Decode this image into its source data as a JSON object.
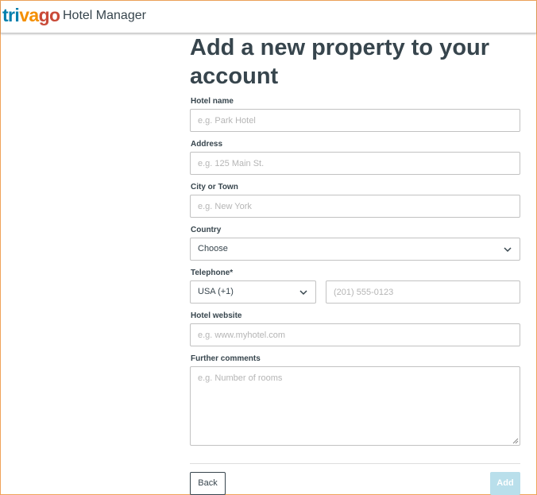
{
  "header": {
    "logo": {
      "part1": "tri",
      "part2": "va",
      "part3": "go"
    },
    "app_name": "Hotel Manager"
  },
  "page": {
    "title": "Add a new property to your account"
  },
  "form": {
    "hotel_name": {
      "label": "Hotel name",
      "placeholder": "e.g. Park Hotel"
    },
    "address": {
      "label": "Address",
      "placeholder": "e.g. 125 Main St."
    },
    "city": {
      "label": "City or Town",
      "placeholder": "e.g. New York"
    },
    "country": {
      "label": "Country",
      "value": "Choose"
    },
    "telephone": {
      "label": "Telephone*",
      "country_code": "USA (+1)",
      "placeholder": "(201) 555-0123"
    },
    "website": {
      "label": "Hotel website",
      "placeholder": "e.g. www.myhotel.com"
    },
    "comments": {
      "label": "Further comments",
      "placeholder": "e.g. Number of rooms"
    }
  },
  "actions": {
    "back_label": "Back",
    "add_label": "Add"
  },
  "colors": {
    "logo_blue": "#007fad",
    "logo_orange": "#f48f00",
    "logo_red": "#c94a38",
    "text": "#37454d",
    "add_disabled": "#b9dfeb"
  },
  "icons": {
    "dropdown": "chevron-down-icon",
    "resize": "resize-grip-icon"
  }
}
